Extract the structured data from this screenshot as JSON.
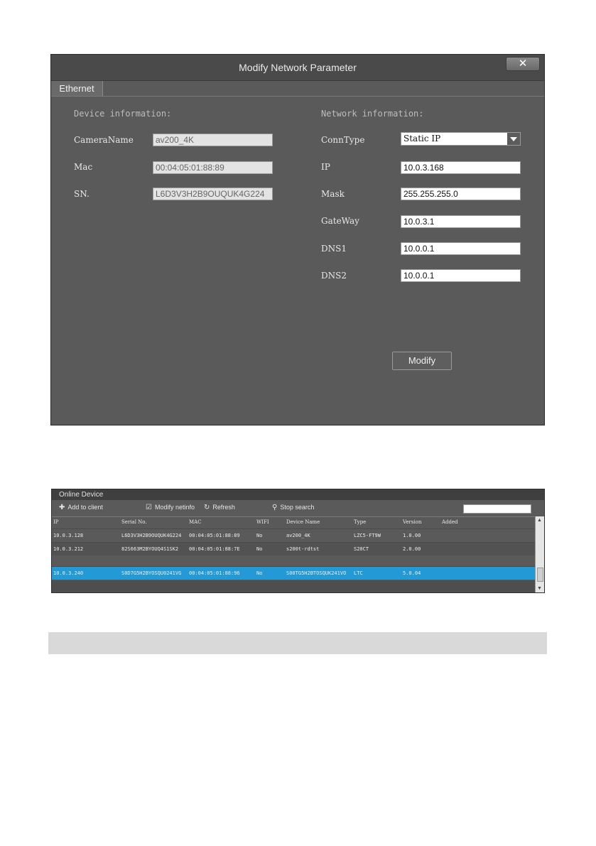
{
  "dialog": {
    "title": "Modify Network Parameter",
    "close_glyph": "✕",
    "tab": "Ethernet",
    "device_section": "Device information:",
    "network_section": "Network information:",
    "device": {
      "camera_name_label": "CameraName",
      "camera_name": "av200_4K",
      "mac_label": "Mac",
      "mac": "00:04:05:01:88:89",
      "sn_label": "SN.",
      "sn": "L6D3V3H2B9OUQUK4G224"
    },
    "network": {
      "conntype_label": "ConnType",
      "conntype": "Static IP",
      "ip_label": "IP",
      "ip": "10.0.3.168",
      "mask_label": "Mask",
      "mask": "255.255.255.0",
      "gateway_label": "GateWay",
      "gateway": "10.0.3.1",
      "dns1_label": "DNS1",
      "dns1": "10.0.0.1",
      "dns2_label": "DNS2",
      "dns2": "10.0.0.1"
    },
    "modify_button": "Modify"
  },
  "online": {
    "title": "Online Device",
    "toolbar": {
      "add": "Add to client",
      "modify": "Modify netinfo",
      "refresh": "Refresh",
      "stop": "Stop search",
      "add_icon": "plus-icon",
      "modify_icon": "checkbox-icon",
      "refresh_icon": "refresh-icon",
      "stop_icon": "search-icon"
    },
    "columns": [
      "IP",
      "Serial No.",
      "MAC",
      "WIFI",
      "Device Name",
      "Type",
      "Version",
      "Added"
    ],
    "rows": [
      [
        "10.0.3.128",
        "L6D3V3H2B9OUQUK4G224",
        "00:04:05:01:88:89",
        "No",
        "av200_4K",
        "LZC5-FT9W",
        "1.0.00",
        ""
      ],
      [
        "10.0.3.212",
        "82S663M2BYOUQ4S1SK2",
        "00:04:05:01:88:7E",
        "No",
        "s200t-rdtst",
        "S20CT",
        "2.0.00",
        ""
      ],
      [
        "10.0.3.240",
        "S0D7G5H2BYOSQU0241VG",
        "00:04:05:01:88:96",
        "No",
        "S00TG5H2BTOSQUK241VO",
        "LTC",
        "5.0.04",
        ""
      ]
    ],
    "selected_row": 2
  },
  "colors": {
    "dialog_bg": "#5a5a5a",
    "selected_row": "#2399d6",
    "strip": "#d9d9d9"
  }
}
